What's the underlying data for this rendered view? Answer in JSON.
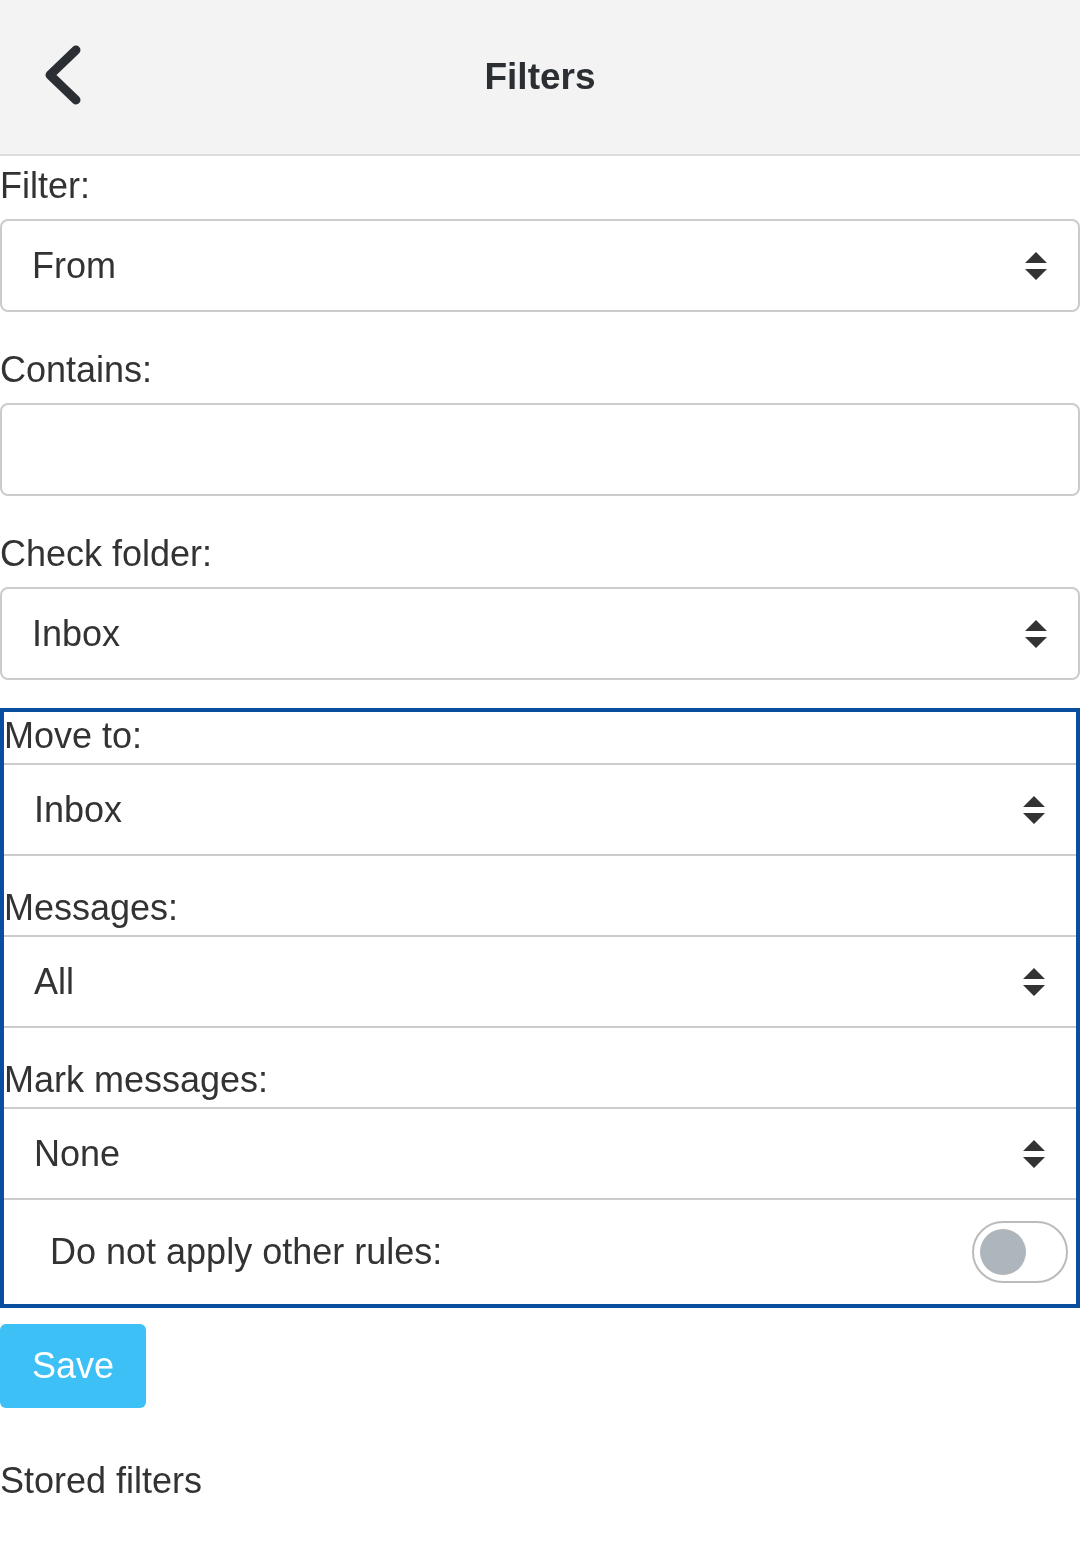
{
  "header": {
    "title": "Filters"
  },
  "fields": [
    {
      "label": "Filter:",
      "kind": "select",
      "value": "From"
    },
    {
      "label": "Contains:",
      "kind": "text"
    },
    {
      "label": "Check folder:",
      "kind": "select",
      "value": "Inbox"
    }
  ],
  "action_group": {
    "fields": [
      {
        "label": "Move to:",
        "kind": "select",
        "value": "Inbox"
      },
      {
        "label": "Messages:",
        "kind": "select",
        "value": "All"
      },
      {
        "label": "Mark messages:",
        "kind": "select",
        "value": "None"
      }
    ],
    "toggle": {
      "label": "Do not apply other rules:",
      "on": false
    }
  },
  "save_button": "Save",
  "section_title": "Stored filters"
}
